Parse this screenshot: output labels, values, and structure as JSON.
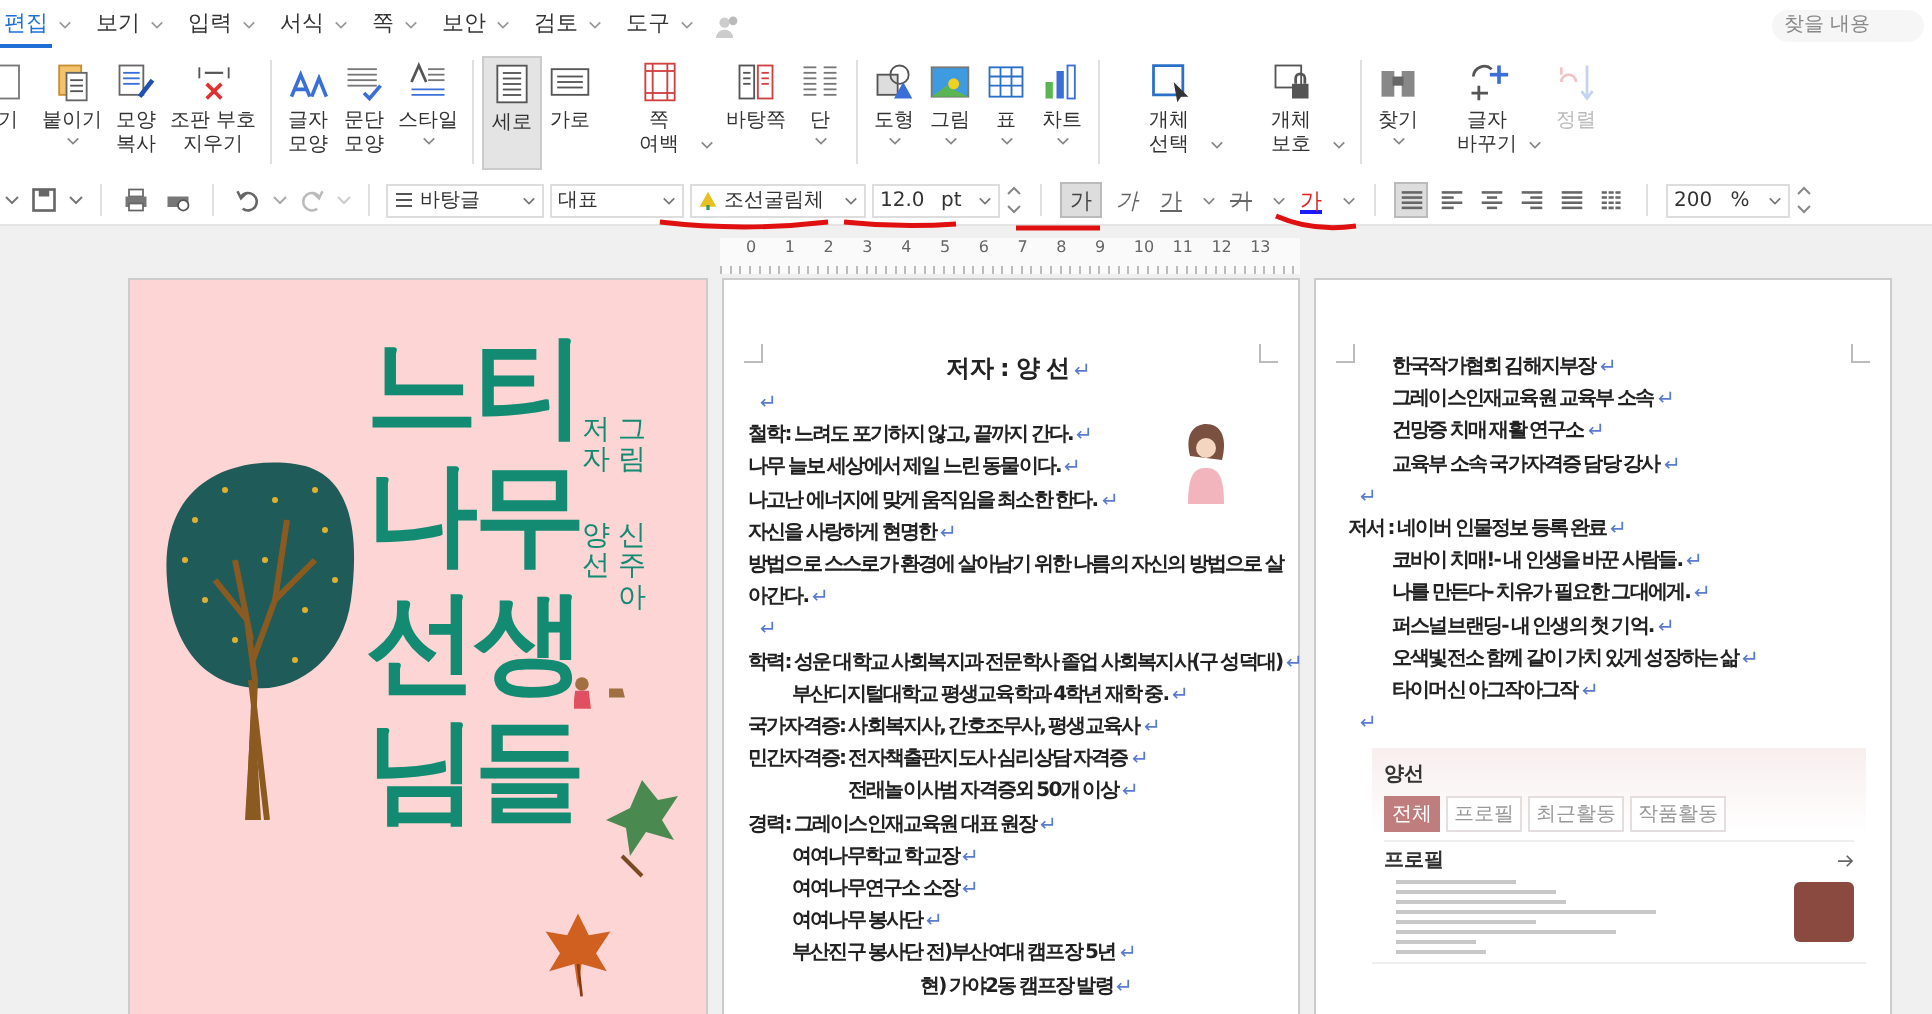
{
  "menu": {
    "items": [
      {
        "label": "편집",
        "selected": true
      },
      {
        "label": "보기",
        "selected": false
      },
      {
        "label": "입력",
        "selected": false
      },
      {
        "label": "서식",
        "selected": false
      },
      {
        "label": "쪽",
        "selected": false
      },
      {
        "label": "보안",
        "selected": false
      },
      {
        "label": "검토",
        "selected": false
      },
      {
        "label": "도구",
        "selected": false
      }
    ],
    "search": {
      "placeholder": "찾을 내용"
    }
  },
  "ribbon": {
    "groups": [
      [
        {
          "lines": [
            "기"
          ],
          "dropdown": false,
          "selected": false,
          "disabled": false
        },
        {
          "lines": [
            "붙이기"
          ],
          "dropdown": true,
          "selected": false,
          "disabled": false
        },
        {
          "lines": [
            "모양",
            "복사"
          ],
          "dropdown": false,
          "selected": false,
          "disabled": false
        },
        {
          "lines": [
            "조판 부호",
            "지우기"
          ],
          "dropdown": false,
          "selected": false,
          "disabled": false
        }
      ],
      [
        {
          "lines": [
            "글자",
            "모양"
          ],
          "dropdown": false,
          "selected": false,
          "disabled": false
        },
        {
          "lines": [
            "문단",
            "모양"
          ],
          "dropdown": false,
          "selected": false,
          "disabled": false
        },
        {
          "lines": [
            "스타일"
          ],
          "dropdown": true,
          "selected": false,
          "disabled": false
        }
      ],
      [
        {
          "lines": [
            "세로"
          ],
          "dropdown": false,
          "selected": true,
          "disabled": false
        },
        {
          "lines": [
            "가로"
          ],
          "dropdown": false,
          "selected": false,
          "disabled": false
        },
        {
          "lines": [
            "쪽",
            "여백"
          ],
          "dropdown": true,
          "selected": false,
          "disabled": false
        },
        {
          "lines": [
            "바탕쪽"
          ],
          "dropdown": false,
          "selected": false,
          "disabled": false
        },
        {
          "lines": [
            "단"
          ],
          "dropdown": true,
          "selected": false,
          "disabled": false
        }
      ],
      [
        {
          "lines": [
            "도형"
          ],
          "dropdown": true,
          "selected": false,
          "disabled": false
        },
        {
          "lines": [
            "그림"
          ],
          "dropdown": true,
          "selected": false,
          "disabled": false
        },
        {
          "lines": [
            "표"
          ],
          "dropdown": true,
          "selected": false,
          "disabled": false
        },
        {
          "lines": [
            "차트"
          ],
          "dropdown": true,
          "selected": false,
          "disabled": false
        }
      ],
      [
        {
          "lines": [
            "개체",
            "선택"
          ],
          "dropdown": true,
          "selected": false,
          "disabled": false
        },
        {
          "lines": [
            "개체",
            "보호"
          ],
          "dropdown": true,
          "selected": false,
          "disabled": false
        }
      ],
      [
        {
          "lines": [
            "찾기"
          ],
          "dropdown": true,
          "selected": false,
          "disabled": false
        },
        {
          "lines": [
            "글자",
            "바꾸기"
          ],
          "dropdown": true,
          "selected": false,
          "disabled": false
        },
        {
          "lines": [
            "정렬"
          ],
          "dropdown": false,
          "selected": false,
          "disabled": true
        }
      ]
    ]
  },
  "format_bar": {
    "style": "바탕글",
    "language": "대표",
    "font": "조선굴림체",
    "size": "12.0",
    "unit": "pt",
    "char_buttons": [
      {
        "kind": "bold",
        "label": "가",
        "selected": true,
        "dropdown": false
      },
      {
        "kind": "italic",
        "label": "가",
        "selected": false,
        "dropdown": false
      },
      {
        "kind": "underline",
        "label": "가",
        "selected": false,
        "dropdown": true
      },
      {
        "kind": "strike",
        "label": "가",
        "selected": false,
        "dropdown": true
      },
      {
        "kind": "color",
        "label": "가",
        "selected": false,
        "dropdown": true
      }
    ],
    "align_buttons": [
      {
        "kind": "justify",
        "selected": true
      },
      {
        "kind": "left",
        "selected": false
      },
      {
        "kind": "center",
        "selected": false
      },
      {
        "kind": "right",
        "selected": false
      },
      {
        "kind": "distribute",
        "selected": false
      },
      {
        "kind": "split",
        "selected": false
      }
    ],
    "zoom": "200",
    "zoom_unit": "%"
  },
  "ruler": {
    "labels": [
      "0",
      "1",
      "2",
      "3",
      "4",
      "5",
      "6",
      "7",
      "8",
      "9",
      "10",
      "11",
      "12",
      "13"
    ]
  },
  "cover": {
    "title_lines": [
      "느티",
      "나무",
      "선생",
      "님들"
    ],
    "credits": [
      {
        "role": "저자",
        "name": "양선"
      },
      {
        "role": "그림",
        "name": "신주아"
      }
    ]
  },
  "pages": [
    {
      "lines": [
        {
          "kind": "title",
          "text": "저자 : 양 선"
        },
        {
          "kind": "blank"
        },
        {
          "kind": "line",
          "text": "철학: 느려도 포기하지 않고, 끝까지 간다."
        },
        {
          "kind": "line",
          "text": "나무 늘보 세상에서 제일 느린 동물이다."
        },
        {
          "kind": "line",
          "text": "나고난 에너지에 맞게 움직임을 최소한 한다."
        },
        {
          "kind": "line",
          "text": "자신을 사랑하게 현명한"
        },
        {
          "kind": "wrapped",
          "text": "방법으로 스스로가 환경에 살아남기 위한 나름의 자신의 방법으로 살"
        },
        {
          "kind": "continued",
          "text": "아간다."
        },
        {
          "kind": "blank"
        },
        {
          "kind": "line",
          "text": "학력: 성운 대학교 사회복지과 전문학사 졸업 사회복지사(구 성덕대)"
        },
        {
          "kind": "indent",
          "text": "부산디지털대학교 평생교육학과 4학년 재학 중."
        },
        {
          "kind": "line",
          "text": "국가자격증: 사회복지사, 간호조무사, 평생교육사"
        },
        {
          "kind": "line",
          "text": "민간자격증: 전자책출판지도사 심리상담 자격증"
        },
        {
          "kind": "deep",
          "text": "전래놀이사범 자격증외 50개 이상"
        },
        {
          "kind": "line",
          "text": "경력: 그레이스인재교육원 대표 원장"
        },
        {
          "kind": "indent",
          "text": "여여나무학교 학교장"
        },
        {
          "kind": "indent",
          "text": "여여나무연구소 소장"
        },
        {
          "kind": "indent",
          "text": "여여나무 봉사단"
        },
        {
          "kind": "indent",
          "text": "부산진구 봉사단 전)부산여대 캠프장 5년"
        },
        {
          "kind": "deeper",
          "text": "현) 가야2동 캠프장 발령"
        }
      ]
    },
    {
      "lines": [
        {
          "kind": "indent",
          "text": "한국작가협회 김해지부장"
        },
        {
          "kind": "indent",
          "text": "그레이스인재교육원 교육부 소속"
        },
        {
          "kind": "indent",
          "text": "건망증 치매 재활 연구소"
        },
        {
          "kind": "indent",
          "text": "교육부 소속 국가자격증 담당 강사"
        },
        {
          "kind": "blank"
        },
        {
          "kind": "line",
          "text": "저서 : 네이버 인물정보 등록 완료"
        },
        {
          "kind": "indent",
          "text": "코바이 치매!- 내 인생을 바꾼 사람들."
        },
        {
          "kind": "indent",
          "text": "나를 만든다- 치유가 필요한 그대에게."
        },
        {
          "kind": "indent",
          "text": "퍼스널브랜딩- 내 인생의 첫 기억."
        },
        {
          "kind": "indent",
          "text": "오색빛전소 함께 같이 가치 있게 성장하는 삶"
        },
        {
          "kind": "indent",
          "text": "타이머신 아그작아그작"
        },
        {
          "kind": "blank"
        }
      ]
    }
  ],
  "profile_card": {
    "name": "양선",
    "tabs": [
      {
        "label": "전체",
        "selected": true
      },
      {
        "label": "프로필",
        "selected": false
      },
      {
        "label": "최근활동",
        "selected": false
      },
      {
        "label": "작품활동",
        "selected": false
      }
    ],
    "section": "프로필"
  }
}
